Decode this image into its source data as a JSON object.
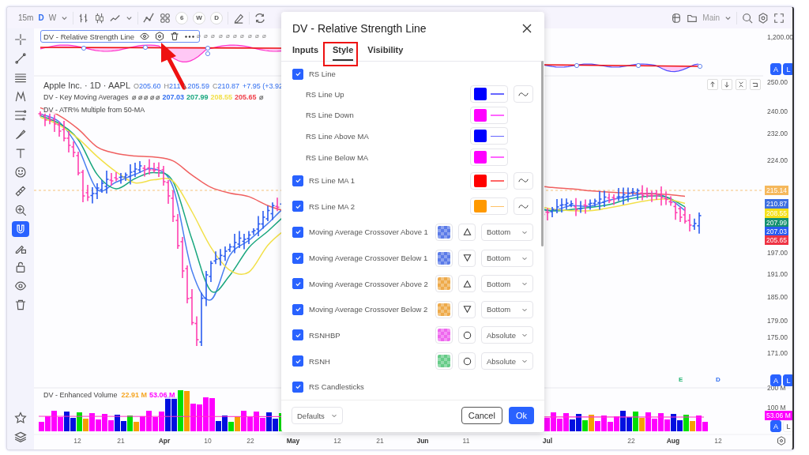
{
  "toolbar": {
    "intervals": [
      {
        "label": "15m",
        "selected": false
      },
      {
        "label": "D",
        "selected": true
      },
      {
        "label": "W",
        "selected": false
      }
    ],
    "quick_intervals": [
      {
        "label": "6"
      },
      {
        "label": "W"
      },
      {
        "label": "D"
      }
    ],
    "layout": {
      "label": "Main"
    }
  },
  "tools": [
    {
      "kind": "crosshair",
      "selected": false
    },
    {
      "kind": "trendline",
      "selected": false
    },
    {
      "kind": "hlines",
      "selected": false
    },
    {
      "kind": "pattern",
      "selected": false
    },
    {
      "kind": "fib",
      "selected": false
    },
    {
      "kind": "brush",
      "selected": false
    },
    {
      "kind": "text",
      "selected": false
    },
    {
      "kind": "emoji",
      "selected": false
    },
    {
      "kind": "ruler",
      "selected": false
    },
    {
      "kind": "zoom",
      "selected": false
    },
    {
      "kind": "magnet",
      "selected": true
    },
    {
      "kind": "pencil-lock",
      "selected": false
    },
    {
      "kind": "lock",
      "selected": false
    },
    {
      "kind": "eye",
      "selected": false
    },
    {
      "kind": "trash",
      "selected": false
    }
  ],
  "bottom_tools": [
    {
      "kind": "star"
    },
    {
      "kind": "layers"
    }
  ],
  "legends": {
    "rs_line": {
      "title": "DV - Relative Strength Line",
      "values": "⌀ ⌀ ⌀ ⌀ ⌀ ⌀ ⌀ ⌀ ⌀ ⌀"
    },
    "symbol": {
      "title": "Apple Inc. · 1D · AAPL",
      "ohlc": [
        {
          "label": "O",
          "value": "205.60"
        },
        {
          "label": "H",
          "value": "211"
        },
        {
          "label": "L",
          "value": "205.59"
        },
        {
          "label": "C",
          "value": "210.87"
        }
      ],
      "change": "+7.95 (+3.92"
    },
    "indicators": [
      {
        "title": "DV - Key Moving Averages",
        "values": [
          {
            "text": "⌀ ⌀ ⌀ ⌀ ⌀",
            "color": "#777777"
          },
          {
            "text": "207.03",
            "color": "#2f6df0"
          },
          {
            "text": "207.99",
            "color": "#18a67e"
          },
          {
            "text": "208.55",
            "color": "#f2e04a"
          },
          {
            "text": "205.65",
            "color": "#f0404a"
          },
          {
            "text": "⌀",
            "color": "#777777"
          }
        ]
      },
      {
        "title": "DV - ATR% Multiple from 50-MA"
      }
    ],
    "volume": {
      "title": "DV - Enhanced Volume",
      "values": [
        {
          "text": "22.91 M",
          "color": "#f5a623"
        },
        {
          "text": "53.06 M",
          "color": "#ff00ff"
        }
      ]
    }
  },
  "price_axis": [
    {
      "label": "1,200.00"
    },
    {
      "label": "250.00"
    },
    {
      "label": "240.00"
    },
    {
      "label": "232.00"
    },
    {
      "label": "224.00"
    },
    {
      "label": "215.14",
      "color": "#f5b85c"
    },
    {
      "label": "210.87",
      "color": "#3d6fe0"
    },
    {
      "label": "208.55",
      "color": "#f5e11a"
    },
    {
      "label": "207.99",
      "color": "#149170"
    },
    {
      "label": "207.03",
      "color": "#2a5cf0"
    },
    {
      "label": "205.65",
      "color": "#ee3344"
    },
    {
      "label": "197.00"
    },
    {
      "label": "191.00"
    },
    {
      "label": "185.00"
    },
    {
      "label": "179.00"
    },
    {
      "label": "175.00"
    },
    {
      "label": "171.00"
    },
    {
      "label": "200 M"
    },
    {
      "label": "100 M"
    },
    {
      "label": "53.06 M",
      "color": "#ff00ff"
    }
  ],
  "scale_buttons": [
    {
      "buttons": [
        {
          "label": "A",
          "selected": true
        },
        {
          "label": "L",
          "selected": true
        }
      ]
    },
    {
      "buttons": [
        {
          "label": "A",
          "selected": true
        },
        {
          "label": "L",
          "selected": true
        }
      ]
    },
    {
      "buttons": [
        {
          "label": "A",
          "selected": true
        },
        {
          "label": "L",
          "selected": false
        }
      ]
    }
  ],
  "events": [
    {
      "label": "E",
      "color": "#22b573"
    },
    {
      "label": "D",
      "color": "#2f6df0"
    }
  ],
  "date_axis": [
    {
      "label": "12",
      "major": false
    },
    {
      "label": "21",
      "major": false
    },
    {
      "label": "Apr",
      "major": true
    },
    {
      "label": "10",
      "major": false
    },
    {
      "label": "22",
      "major": false
    },
    {
      "label": "May",
      "major": true
    },
    {
      "label": "12",
      "major": false
    },
    {
      "label": "21",
      "major": false
    },
    {
      "label": "Jun",
      "major": true
    },
    {
      "label": "11",
      "major": false
    },
    {
      "label": "Jul",
      "major": true
    },
    {
      "label": "22",
      "major": false
    },
    {
      "label": "Aug",
      "major": true
    },
    {
      "label": "12",
      "major": false
    }
  ],
  "dialog": {
    "title": "DV - Relative Strength Line",
    "tabs": [
      {
        "label": "Inputs",
        "selected": false
      },
      {
        "label": "Style",
        "selected": true
      },
      {
        "label": "Visibility",
        "selected": false
      }
    ],
    "rows": [
      {
        "kind": "toggle",
        "label": "RS Line",
        "checked": true
      },
      {
        "kind": "line",
        "label": "RS Line Up",
        "color": "#0000ff",
        "wave": true
      },
      {
        "kind": "line",
        "label": "RS Line Down",
        "color": "#ff00ff",
        "wave": false
      },
      {
        "kind": "line",
        "label": "RS Line Above MA",
        "color": "#0000ff",
        "wave": false
      },
      {
        "kind": "line",
        "label": "RS Line Below MA",
        "color": "#ff00ff",
        "wave": false
      },
      {
        "kind": "line",
        "label": "RS Line MA 1",
        "checked": true,
        "color": "#ff0000",
        "wave": true
      },
      {
        "kind": "line",
        "label": "RS Line MA 2",
        "checked": true,
        "color": "#ff9900",
        "wave": true
      },
      {
        "kind": "shape",
        "label": "Moving Average Crossover Above 1",
        "checked": true,
        "color": "#5b7be8",
        "shape": {
          "kind": "triangle-up"
        },
        "location": "Bottom"
      },
      {
        "kind": "shape",
        "label": "Moving Average Crossover Below 1",
        "checked": true,
        "color": "#5b7be8",
        "shape": {
          "kind": "triangle-down"
        },
        "location": "Bottom"
      },
      {
        "kind": "shape",
        "label": "Moving Average Crossover Above 2",
        "checked": true,
        "color": "#eeaa4a",
        "shape": {
          "kind": "triangle-up"
        },
        "location": "Bottom"
      },
      {
        "kind": "shape",
        "label": "Moving Average Crossover Below 2",
        "checked": true,
        "color": "#eeaa4a",
        "shape": {
          "kind": "triangle-down"
        },
        "location": "Bottom"
      },
      {
        "kind": "shape",
        "label": "RSNHBP",
        "checked": true,
        "color": "#ee66ee",
        "shape": {
          "kind": "circle"
        },
        "location": "Absolute"
      },
      {
        "kind": "shape",
        "label": "RSNH",
        "checked": true,
        "color": "#66cc88",
        "shape": {
          "kind": "circle"
        },
        "location": "Absolute"
      },
      {
        "kind": "toggle",
        "label": "RS Candlesticks",
        "checked": true
      }
    ],
    "defaults": "Defaults",
    "cancel": "Cancel",
    "ok": "Ok"
  }
}
